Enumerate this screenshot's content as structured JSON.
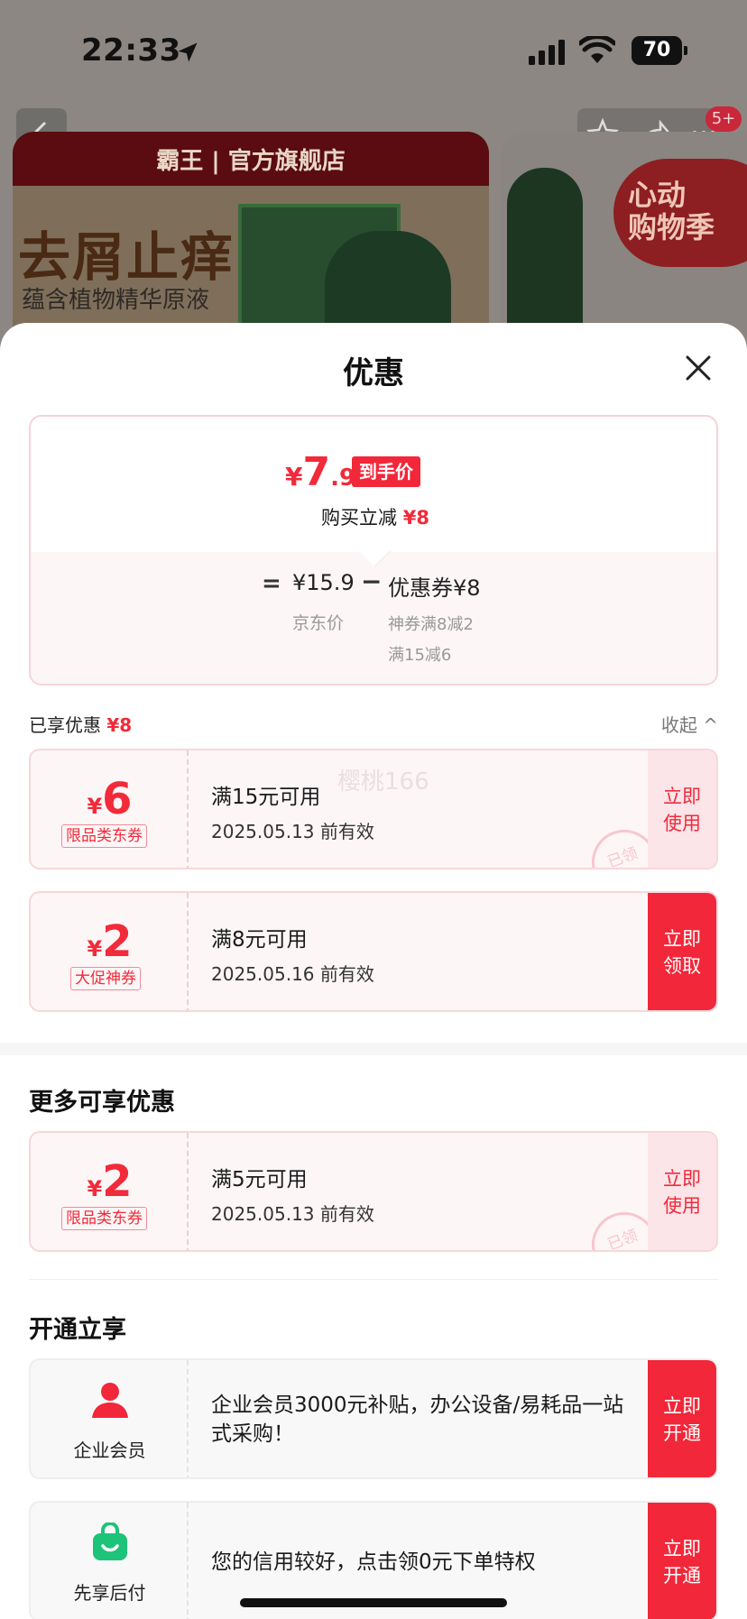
{
  "status_bar": {
    "time": "22:33",
    "battery": "70"
  },
  "background": {
    "badge": "5+",
    "brand": "霸王 | 官方旗舰店",
    "slogan": "去屑止痒",
    "subtitle": "蕴含植物精华原液",
    "side_badge": "心动\n购物季"
  },
  "sheet": {
    "title": "优惠",
    "price": {
      "yen": "¥",
      "integer": "7",
      "decimal": ".9",
      "tag": "到手价",
      "reduce_prefix": "购买立减 ",
      "reduce_amount": "¥8",
      "eq": "=",
      "jd_price": "¥15.9",
      "jd_label": "京东价",
      "minus": "−",
      "coupon_total": "优惠券¥8",
      "coupon_detail_1": "神券满8减2",
      "coupon_detail_2": "满15减6"
    },
    "enjoyed": {
      "label": "已享优惠 ",
      "amount": "¥8",
      "collapse": "收起 ^"
    },
    "applied_coupons": [
      {
        "yen": "¥",
        "amount": "6",
        "type": "限品类东券",
        "condition": "满15元可用",
        "expiry": "2025.05.13 前有效",
        "button": "立即\n使用",
        "stamp": "已领",
        "watermark": "樱桃166"
      },
      {
        "yen": "¥",
        "amount": "2",
        "type": "大促神券",
        "condition": "满8元可用",
        "expiry": "2025.05.16 前有效",
        "button": "立即\n领取"
      }
    ],
    "more_title": "更多可享优惠",
    "more_coupons": [
      {
        "yen": "¥",
        "amount": "2",
        "type": "限品类东券",
        "condition": "满5元可用",
        "expiry": "2025.05.13 前有效",
        "button": "立即\n使用",
        "stamp": "已领"
      }
    ],
    "open_title": "开通立享",
    "perks": [
      {
        "name": "企业会员",
        "icon": "person-icon",
        "desc": " 企业会员3000元补贴，办公设备/易耗品一站式采购！",
        "button": "立即\n开通"
      },
      {
        "name": "先享后付",
        "icon": "shopping-bag-icon",
        "desc": "您的信用较好，点击领0元下单特权",
        "button": "立即\n开通"
      }
    ]
  },
  "colors": {
    "accent": "#f2273a",
    "coupon_bg": "#fdf6f7",
    "perk_bg": "#f8f8f9"
  }
}
